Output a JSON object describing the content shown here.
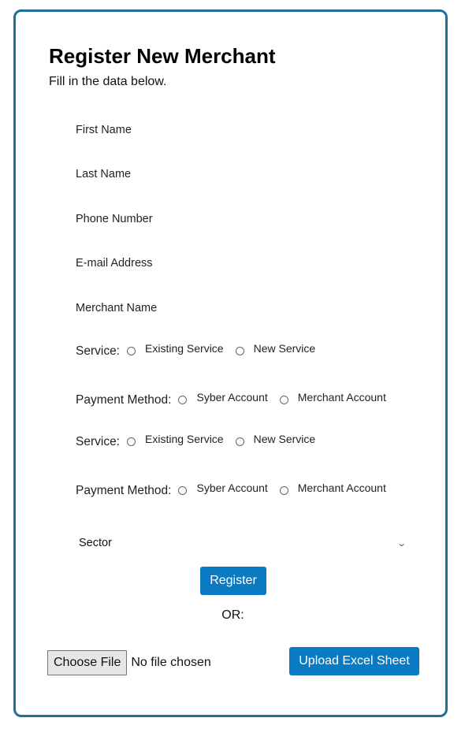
{
  "form": {
    "title": "Register New Merchant",
    "subtitle": "Fill in the data below.",
    "fields": {
      "first_name": {
        "placeholder": "First Name",
        "value": ""
      },
      "last_name": {
        "placeholder": "Last Name",
        "value": ""
      },
      "phone_number": {
        "placeholder": "Phone Number",
        "value": ""
      },
      "email": {
        "placeholder": "E-mail Address",
        "value": ""
      },
      "merchant_name": {
        "placeholder": "Merchant Name",
        "value": ""
      }
    },
    "service_groups": [
      {
        "service_label": "Service:",
        "service_options": [
          "Existing Service",
          "New Service"
        ],
        "payment_label": "Payment Method:",
        "payment_options": [
          "Syber Account",
          "Merchant Account"
        ]
      },
      {
        "service_label": "Service:",
        "service_options": [
          "Existing Service",
          "New Service"
        ],
        "payment_label": "Payment Method:",
        "payment_options": [
          "Syber Account",
          "Merchant Account"
        ]
      }
    ],
    "sector_select": {
      "selected": "Sector",
      "icon": "chevron-down-icon"
    },
    "register_label": "Register",
    "or_label": "OR:",
    "file_upload": {
      "choose_label": "Choose File",
      "status": "No file chosen",
      "upload_label": "Upload Excel Sheet"
    }
  },
  "colors": {
    "card_border": "#1f6f9a",
    "primary_button": "#0a7bc2",
    "primary_button_text": "#ffffff"
  }
}
